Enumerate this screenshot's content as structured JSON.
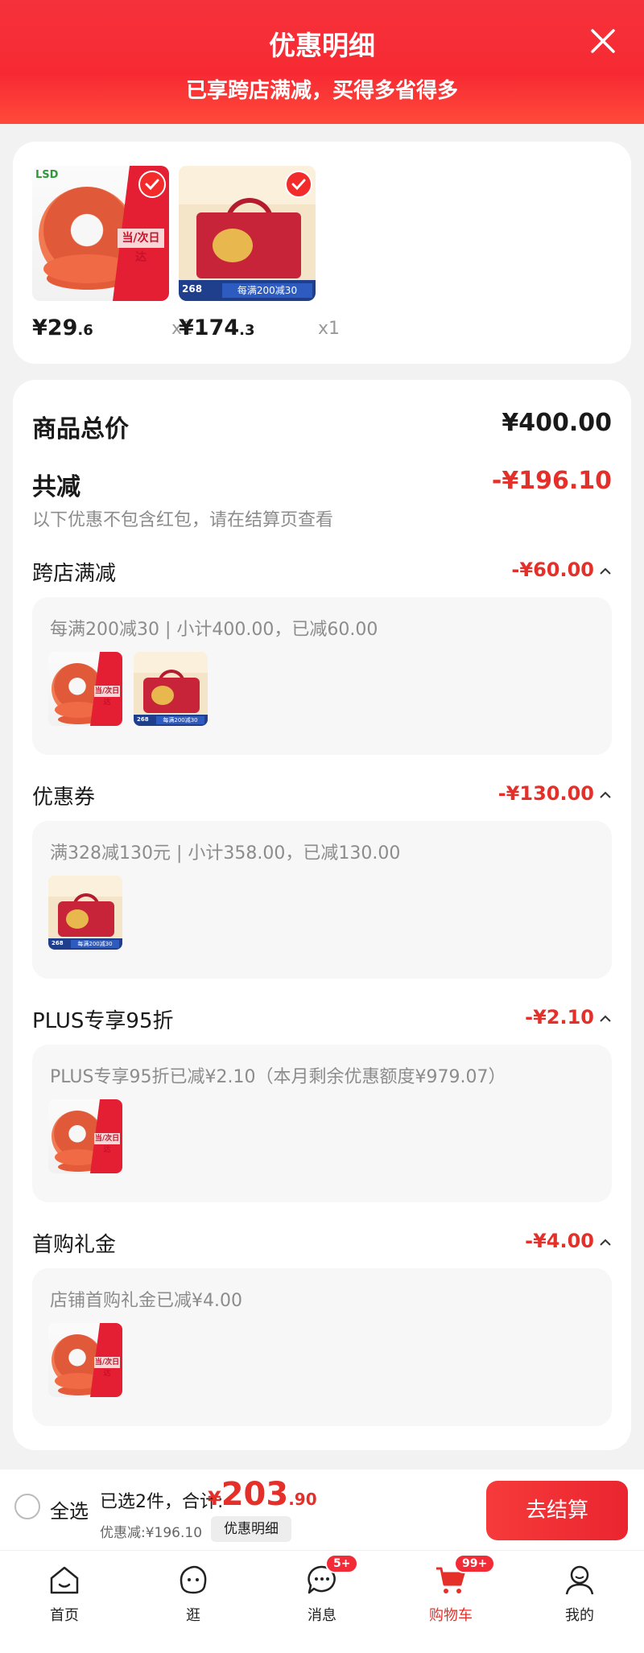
{
  "header": {
    "title": "优惠明细",
    "subtitle": "已享跨店满减，买得多省得多"
  },
  "products": [
    {
      "price_int": "¥29",
      "price_dec": ".6",
      "qty": "x1",
      "image": "tape-rolls",
      "selected": true
    },
    {
      "price_int": "¥174",
      "price_dec": ".3",
      "qty": "x1",
      "image": "gift-box",
      "selected": true
    }
  ],
  "summary": {
    "total_label": "商品总价",
    "total_value": "¥400.00",
    "reduce_label": "共减",
    "reduce_value": "-¥196.10",
    "note": "以下优惠不包含红包，请在结算页查看",
    "sections": [
      {
        "label": "跨店满减",
        "value": "-¥60.00",
        "desc": "每满200减30 | 小计400.00，已减60.00",
        "thumbs": [
          "tape-rolls",
          "gift-box"
        ]
      },
      {
        "label": "优惠券",
        "value": "-¥130.00",
        "desc": "满328减130元 | 小计358.00，已减130.00",
        "thumbs": [
          "gift-box"
        ]
      },
      {
        "label": "PLUS专享95折",
        "value": "-¥2.10",
        "desc": "PLUS专享95折已减¥2.10（本月剩余优惠额度¥979.07）",
        "thumbs": [
          "tape-rolls"
        ]
      },
      {
        "label": "首购礼金",
        "value": "-¥4.00",
        "desc": "店铺首购礼金已减¥4.00",
        "thumbs": [
          "tape-rolls"
        ]
      }
    ]
  },
  "checkout": {
    "select_all": "全选",
    "selected_text": "已选2件，合计:",
    "amount_cur": "¥",
    "amount_int": "203",
    "amount_dec": ".90",
    "discount_text": "优惠减:¥196.10",
    "detail_btn": "优惠明细",
    "pay_btn": "去结算"
  },
  "tabs": [
    {
      "label": "首页",
      "icon": "home-icon"
    },
    {
      "label": "逛",
      "icon": "browse-icon"
    },
    {
      "label": "消息",
      "icon": "message-icon",
      "badge": "5+"
    },
    {
      "label": "购物车",
      "icon": "cart-icon",
      "badge": "99+",
      "active": true
    },
    {
      "label": "我的",
      "icon": "profile-icon"
    }
  ],
  "colors": {
    "accent": "#e5302a",
    "header": "#f5313b"
  }
}
